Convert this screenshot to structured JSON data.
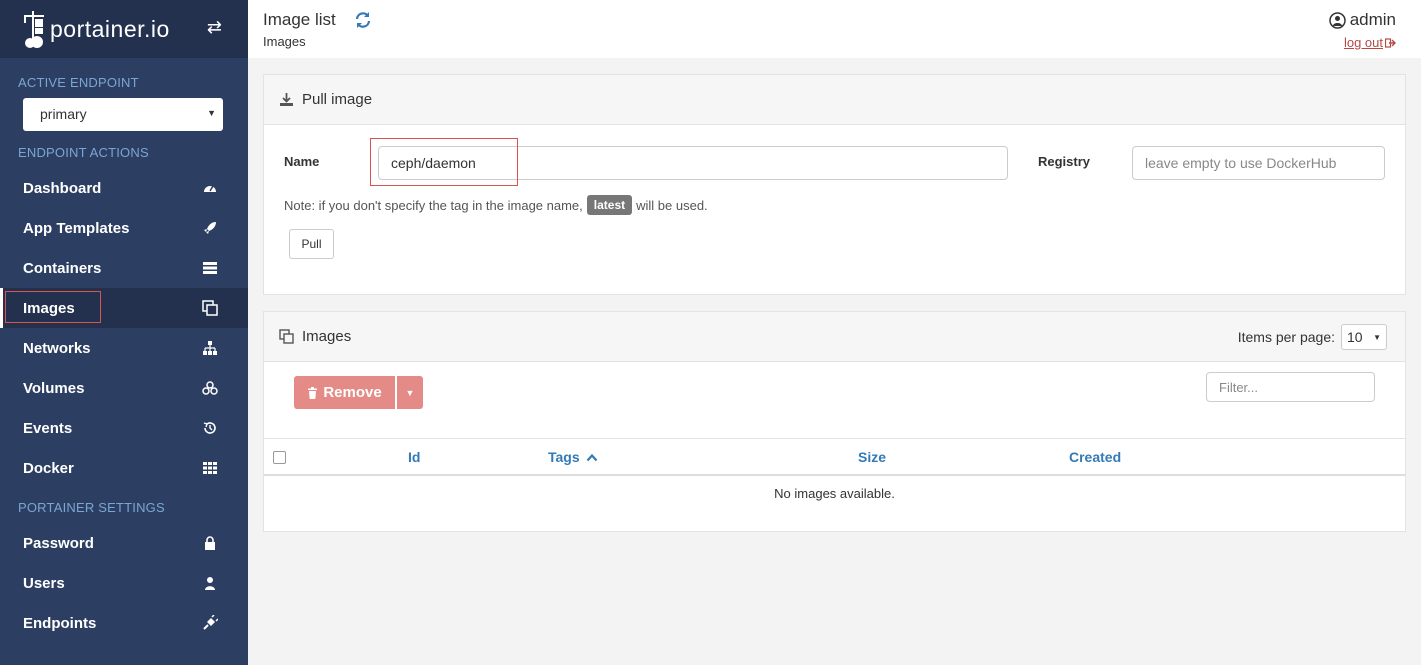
{
  "sidebar": {
    "brand": "portainer.io",
    "active_endpoint_heading": "ACTIVE ENDPOINT",
    "endpoint_selected": "primary",
    "endpoint_actions_heading": "ENDPOINT ACTIONS",
    "items": [
      {
        "label": "Dashboard",
        "icon": "tachometer-icon"
      },
      {
        "label": "App Templates",
        "icon": "rocket-icon"
      },
      {
        "label": "Containers",
        "icon": "server-icon"
      },
      {
        "label": "Images",
        "icon": "clone-icon",
        "active": true
      },
      {
        "label": "Networks",
        "icon": "sitemap-icon"
      },
      {
        "label": "Volumes",
        "icon": "cubes-icon"
      },
      {
        "label": "Events",
        "icon": "history-icon"
      },
      {
        "label": "Docker",
        "icon": "th-icon"
      }
    ],
    "portainer_settings_heading": "PORTAINER SETTINGS",
    "settings_items": [
      {
        "label": "Password",
        "icon": "lock-icon"
      },
      {
        "label": "Users",
        "icon": "user-icon"
      },
      {
        "label": "Endpoints",
        "icon": "plug-icon"
      }
    ]
  },
  "header": {
    "title": "Image list",
    "breadcrumb": "Images",
    "user": "admin",
    "logout": "log out"
  },
  "pull_panel": {
    "heading": "Pull image",
    "name_label": "Name",
    "name_value": "ceph/daemon",
    "registry_label": "Registry",
    "registry_placeholder": "leave empty to use DockerHub",
    "note_prefix": "Note: if you don't specify the tag in the image name,",
    "note_badge": "latest",
    "note_suffix": "will be used.",
    "pull_button": "Pull"
  },
  "images_panel": {
    "heading": "Images",
    "items_per_page_label": "Items per page:",
    "items_per_page_value": "10",
    "remove_button": "Remove",
    "filter_placeholder": "Filter...",
    "columns": [
      "Id",
      "Tags",
      "Size",
      "Created"
    ],
    "empty_message": "No images available."
  },
  "colors": {
    "sidebar_bg": "#2d3e63",
    "sidebar_brand_bg": "#23314f",
    "link_blue": "#337ab7",
    "danger_light": "#e58b87"
  }
}
